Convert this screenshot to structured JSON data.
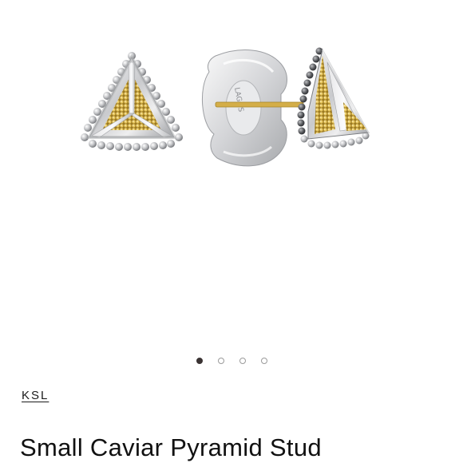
{
  "gallery": {
    "image_alt": "Small Caviar Pyramid Stud earrings",
    "slide_count": 4,
    "active_slide": 1
  },
  "product": {
    "brand": "KSL",
    "title": "Small Caviar Pyramid Stud"
  },
  "colors": {
    "silver": "#d9dadc",
    "gold": "#c9a646",
    "active_dot": "#3a3333"
  }
}
